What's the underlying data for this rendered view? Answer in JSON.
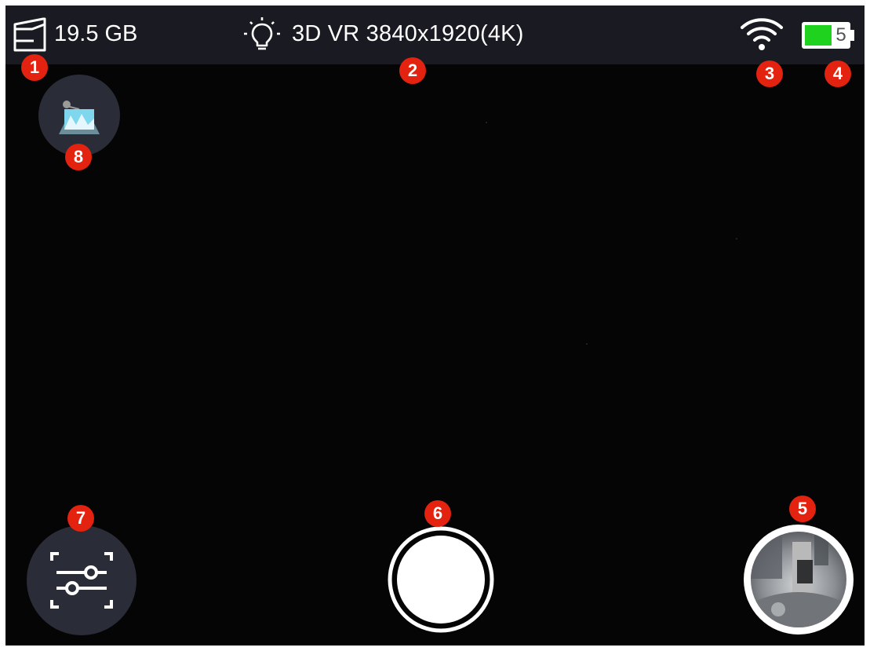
{
  "status_bar": {
    "storage": {
      "icon": "storage-card-icon",
      "value": "19.5 GB"
    },
    "mode": {
      "icon": "light-bulb-icon",
      "label": "3D VR 3840x1920(4K)"
    },
    "wifi": {
      "icon": "wifi-icon"
    },
    "battery": {
      "icon": "battery-icon",
      "level": "5",
      "fill_color": "#1ed21e"
    }
  },
  "controls": {
    "top_left": {
      "icon": "image-stitch-icon"
    },
    "bottom_left": {
      "icon": "settings-sliders-icon"
    },
    "shutter": {
      "icon": "shutter-button"
    },
    "preview": {
      "icon": "gallery-thumbnail"
    }
  },
  "badges": [
    "1",
    "2",
    "3",
    "4",
    "5",
    "6",
    "7",
    "8"
  ],
  "colors": {
    "badge": "#e3220f",
    "topbar": "#1a1b22",
    "background": "#050505",
    "button": "#2a2d38"
  }
}
